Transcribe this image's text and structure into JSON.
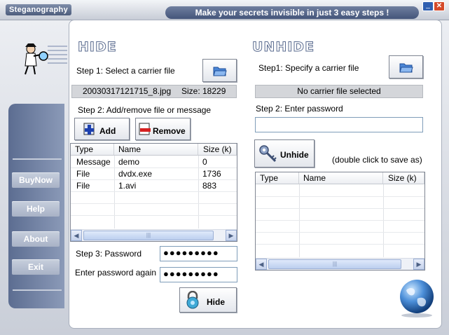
{
  "window": {
    "app_title": "Steganography",
    "slogan": "Make your secrets invisible in just 3 easy steps !",
    "minimize_glyph": "_",
    "close_glyph": "✕"
  },
  "sidebar": {
    "items": [
      {
        "label": "BuyNow"
      },
      {
        "label": "Help"
      },
      {
        "label": "About"
      },
      {
        "label": "Exit"
      }
    ]
  },
  "hide": {
    "heading": "HIDE",
    "step1_label": "Step 1: Select a carrier file",
    "carrier_filename": "20030317121715_8.jpg",
    "carrier_size": "Size: 18229",
    "step2_label": "Step 2: Add/remove file or message",
    "add_label": "Add",
    "remove_label": "Remove",
    "table": {
      "headers": [
        "Type",
        "Name",
        "Size (k)"
      ],
      "rows": [
        [
          "Message",
          "demo",
          "0"
        ],
        [
          "File",
          "dvdx.exe",
          "1736"
        ],
        [
          "File",
          "1.avi",
          "883"
        ]
      ]
    },
    "step3_label": "Step 3: Password",
    "password_value": "●●●●●●●●●",
    "password_again_label": "Enter password again",
    "password_again_value": "●●●●●●●●●",
    "hide_label": "Hide"
  },
  "unhide": {
    "heading": "UNHIDE",
    "step1_label": "Step1: Specify a carrier file",
    "carrier_status": "No carrier file selected",
    "step2_label": "Step 2: Enter password",
    "password_value": "",
    "unhide_label": "Unhide",
    "hint": "(double click to save as)",
    "table": {
      "headers": [
        "Type",
        "Name",
        "Size (k)"
      ],
      "rows": []
    }
  },
  "icons": [
    "detective-icon",
    "folder-open-icon",
    "add-icon",
    "remove-icon",
    "keys-icon",
    "lock-icon",
    "globe-icon"
  ],
  "colors": {
    "accent": "#5a6b8f",
    "sidebar": "#6e7fa2",
    "input_border": "#7f9db9"
  }
}
